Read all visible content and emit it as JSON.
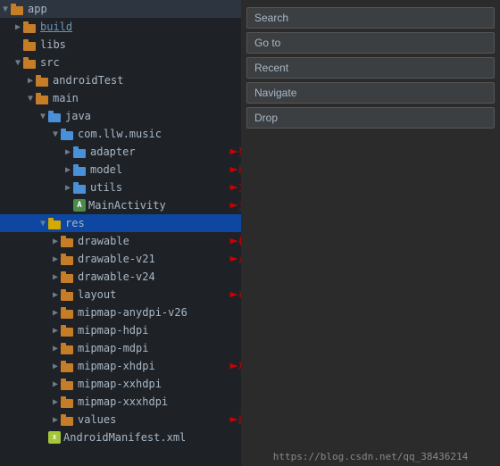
{
  "tree": {
    "items": [
      {
        "id": "app",
        "label": "app",
        "indent": 0,
        "type": "folder-brown",
        "arrow": "▼",
        "selected": false
      },
      {
        "id": "build",
        "label": "build",
        "indent": 1,
        "type": "folder-brown",
        "arrow": "▶",
        "selected": false,
        "underline": true
      },
      {
        "id": "libs",
        "label": "libs",
        "indent": 1,
        "type": "folder-brown",
        "arrow": "",
        "selected": false
      },
      {
        "id": "src",
        "label": "src",
        "indent": 1,
        "type": "folder-brown",
        "arrow": "▼",
        "selected": false
      },
      {
        "id": "androidTest",
        "label": "androidTest",
        "indent": 2,
        "type": "folder-brown",
        "arrow": "▶",
        "selected": false
      },
      {
        "id": "main",
        "label": "main",
        "indent": 2,
        "type": "folder-brown",
        "arrow": "▼",
        "selected": false
      },
      {
        "id": "java",
        "label": "java",
        "indent": 3,
        "type": "folder-blue",
        "arrow": "▼",
        "selected": false
      },
      {
        "id": "com.llw.music",
        "label": "com.llw.music",
        "indent": 4,
        "type": "folder-blue",
        "arrow": "▼",
        "selected": false
      },
      {
        "id": "adapter",
        "label": "adapter",
        "indent": 5,
        "type": "folder-blue",
        "arrow": "▶",
        "selected": false
      },
      {
        "id": "model",
        "label": "model",
        "indent": 5,
        "type": "folder-blue",
        "arrow": "▶",
        "selected": false
      },
      {
        "id": "utils",
        "label": "utils",
        "indent": 5,
        "type": "folder-blue",
        "arrow": "▶",
        "selected": false
      },
      {
        "id": "MainActivity",
        "label": "MainActivity",
        "indent": 5,
        "type": "activity",
        "arrow": "",
        "selected": false
      },
      {
        "id": "res",
        "label": "res",
        "indent": 3,
        "type": "folder-yellow",
        "arrow": "▼",
        "selected": true
      },
      {
        "id": "drawable",
        "label": "drawable",
        "indent": 4,
        "type": "folder-brown",
        "arrow": "▶",
        "selected": false
      },
      {
        "id": "drawable-v21",
        "label": "drawable-v21",
        "indent": 4,
        "type": "folder-brown",
        "arrow": "▶",
        "selected": false
      },
      {
        "id": "drawable-v24",
        "label": "drawable-v24",
        "indent": 4,
        "type": "folder-brown",
        "arrow": "▶",
        "selected": false
      },
      {
        "id": "layout",
        "label": "layout",
        "indent": 4,
        "type": "folder-brown",
        "arrow": "▶",
        "selected": false
      },
      {
        "id": "mipmap-anydpi-v26",
        "label": "mipmap-anydpi-v26",
        "indent": 4,
        "type": "folder-brown",
        "arrow": "▶",
        "selected": false
      },
      {
        "id": "mipmap-hdpi",
        "label": "mipmap-hdpi",
        "indent": 4,
        "type": "folder-brown",
        "arrow": "▶",
        "selected": false
      },
      {
        "id": "mipmap-mdpi",
        "label": "mipmap-mdpi",
        "indent": 4,
        "type": "folder-brown",
        "arrow": "▶",
        "selected": false
      },
      {
        "id": "mipmap-xhdpi",
        "label": "mipmap-xhdpi",
        "indent": 4,
        "type": "folder-brown",
        "arrow": "▶",
        "selected": false
      },
      {
        "id": "mipmap-xxhdpi",
        "label": "mipmap-xxhdpi",
        "indent": 4,
        "type": "folder-brown",
        "arrow": "▶",
        "selected": false
      },
      {
        "id": "mipmap-xxxhdpi",
        "label": "mipmap-xxxhdpi",
        "indent": 4,
        "type": "folder-brown",
        "arrow": "▶",
        "selected": false
      },
      {
        "id": "values",
        "label": "values",
        "indent": 4,
        "type": "folder-brown",
        "arrow": "▶",
        "selected": false
      },
      {
        "id": "AndroidManifest",
        "label": "AndroidManifest.xml",
        "indent": 3,
        "type": "xml",
        "arrow": "",
        "selected": false
      }
    ]
  },
  "annotations": [
    {
      "label": "列表适配器",
      "targetId": "adapter"
    },
    {
      "label": "歌曲数据模型",
      "targetId": "model"
    },
    {
      "label": "工具类，项目中有用到",
      "targetId": "utils"
    },
    {
      "label": "主要代码",
      "targetId": "MainActivity"
    },
    {
      "label": "样式文件",
      "targetId": "drawable"
    },
    {
      "label": "点击的水波纹效果文件",
      "targetId": "drawable-v21"
    },
    {
      "label": "布局文件所在",
      "targetId": "layout"
    },
    {
      "label": "项目中的所有图片图标",
      "targetId": "mipmap-xhdpi"
    },
    {
      "label": "颜色，尺寸文件",
      "targetId": "values"
    }
  ],
  "right_panel": {
    "buttons": [
      {
        "id": "search",
        "label": "Search"
      },
      {
        "id": "goto",
        "label": "Go to"
      },
      {
        "id": "recent",
        "label": "Recent"
      },
      {
        "id": "navigate",
        "label": "Navigate"
      },
      {
        "id": "drop",
        "label": "Drop"
      }
    ]
  },
  "watermark": "https://blog.csdn.net/qq_38436214"
}
